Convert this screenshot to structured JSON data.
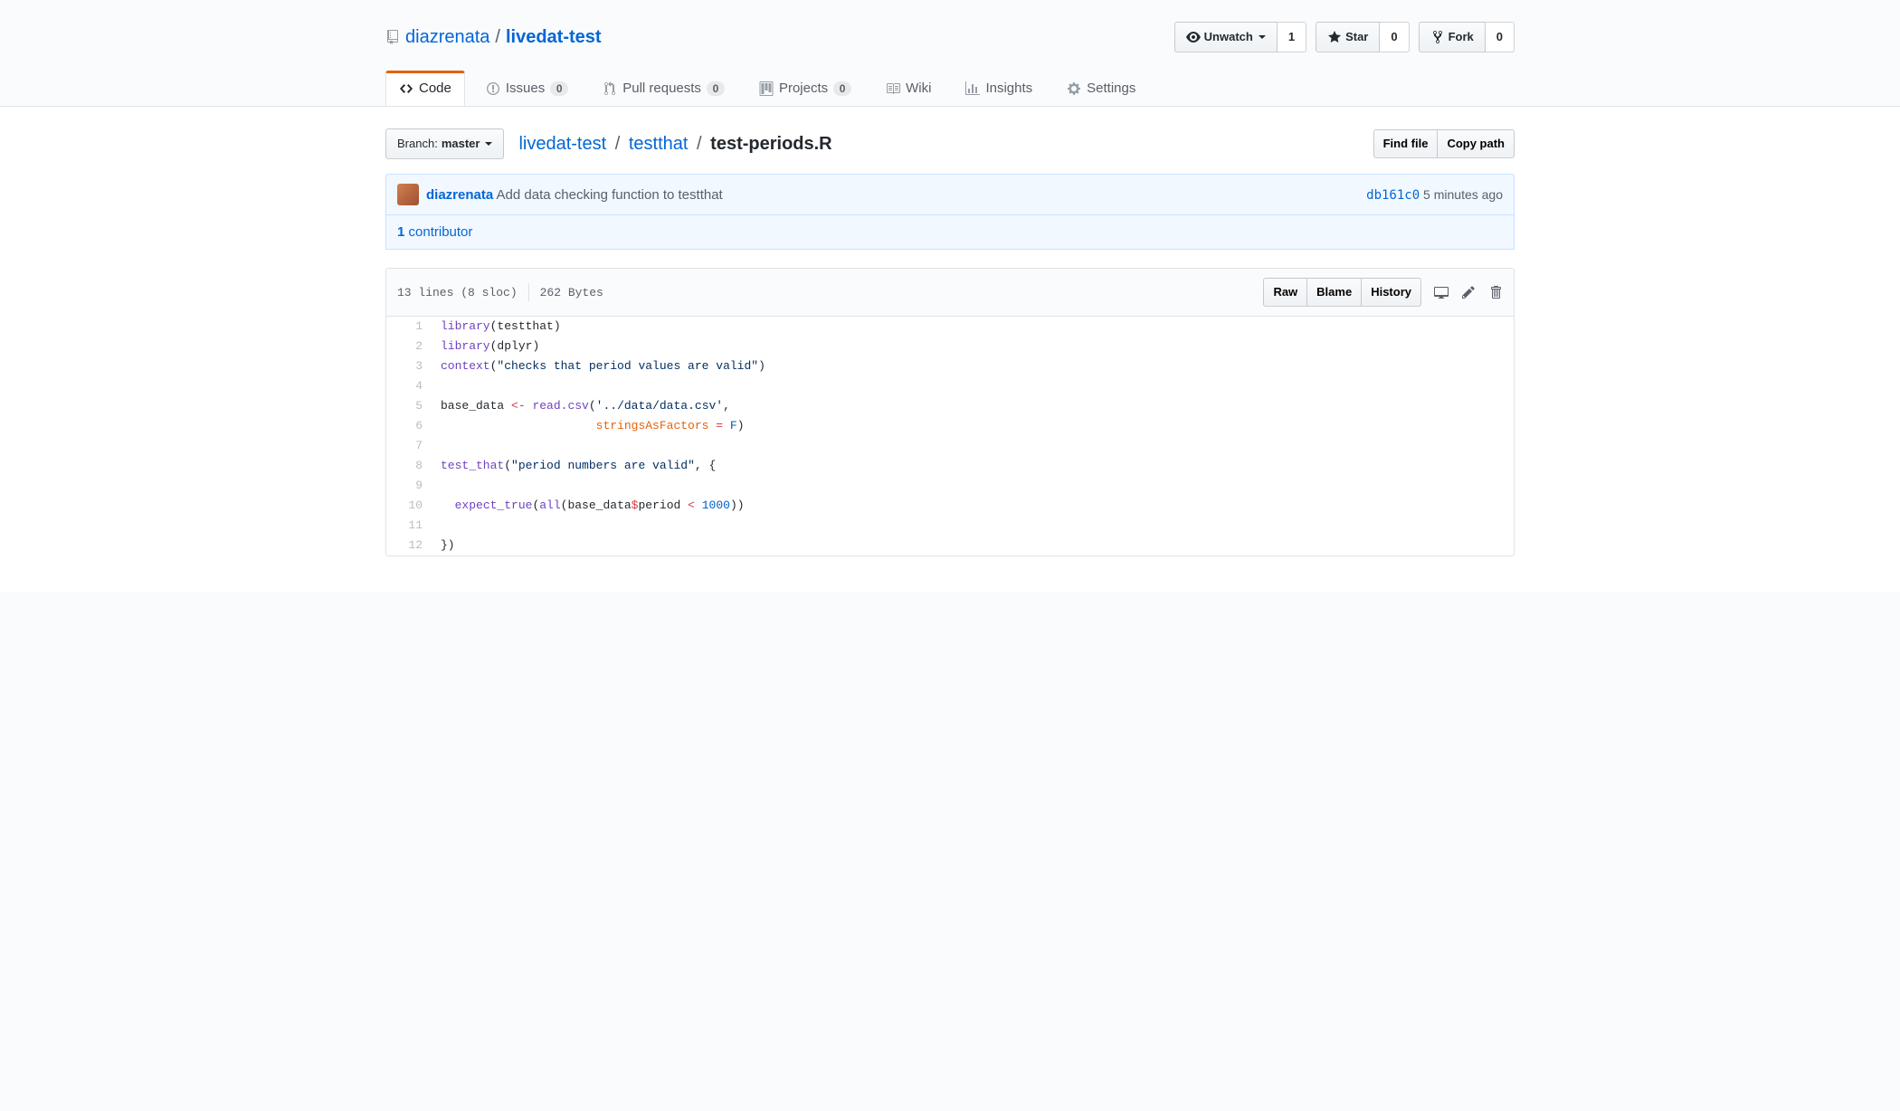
{
  "repo": {
    "owner": "diazrenata",
    "name": "livedat-test",
    "watch_label": "Unwatch",
    "watch_count": "1",
    "star_label": "Star",
    "star_count": "0",
    "fork_label": "Fork",
    "fork_count": "0"
  },
  "tabs": {
    "code": "Code",
    "issues": {
      "label": "Issues",
      "count": "0"
    },
    "pulls": {
      "label": "Pull requests",
      "count": "0"
    },
    "projects": {
      "label": "Projects",
      "count": "0"
    },
    "wiki": "Wiki",
    "insights": "Insights",
    "settings": "Settings"
  },
  "branch": {
    "label_prefix": "Branch:",
    "name": "master"
  },
  "breadcrumb": {
    "root": "livedat-test",
    "dir": "testthat",
    "file": "test-periods.R",
    "sep": "/"
  },
  "buttons": {
    "find_file": "Find file",
    "copy_path": "Copy path",
    "raw": "Raw",
    "blame": "Blame",
    "history": "History"
  },
  "commit": {
    "author": "diazrenata",
    "message": "Add data checking function to testthat",
    "sha": "db161c0",
    "time": "5 minutes ago"
  },
  "contributors": {
    "count": "1",
    "label": "contributor"
  },
  "file_meta": {
    "lines": "13 lines (8 sloc)",
    "bytes": "262 Bytes"
  },
  "code_lines": [
    {
      "n": 1,
      "tokens": [
        {
          "c": "pl-e",
          "t": "library"
        },
        {
          "t": "("
        },
        {
          "t": "testthat"
        },
        {
          "t": ")"
        }
      ]
    },
    {
      "n": 2,
      "tokens": [
        {
          "c": "pl-e",
          "t": "library"
        },
        {
          "t": "("
        },
        {
          "t": "dplyr"
        },
        {
          "t": ")"
        }
      ]
    },
    {
      "n": 3,
      "tokens": [
        {
          "c": "pl-e",
          "t": "context"
        },
        {
          "t": "("
        },
        {
          "c": "pl-s",
          "t": "\"checks that period values are valid\""
        },
        {
          "t": ")"
        }
      ]
    },
    {
      "n": 4,
      "tokens": []
    },
    {
      "n": 5,
      "tokens": [
        {
          "t": "base_data "
        },
        {
          "c": "pl-k",
          "t": "<-"
        },
        {
          "t": " "
        },
        {
          "c": "pl-e",
          "t": "read.csv"
        },
        {
          "t": "("
        },
        {
          "c": "pl-s",
          "t": "'../data/data.csv'"
        },
        {
          "t": ","
        }
      ]
    },
    {
      "n": 6,
      "tokens": [
        {
          "t": "                      "
        },
        {
          "c": "pl-v",
          "t": "stringsAsFactors"
        },
        {
          "t": " "
        },
        {
          "c": "pl-k",
          "t": "="
        },
        {
          "t": " "
        },
        {
          "c": "pl-c1",
          "t": "F"
        },
        {
          "t": ")"
        }
      ]
    },
    {
      "n": 7,
      "tokens": []
    },
    {
      "n": 8,
      "tokens": [
        {
          "c": "pl-e",
          "t": "test_that"
        },
        {
          "t": "("
        },
        {
          "c": "pl-s",
          "t": "\"period numbers are valid\""
        },
        {
          "t": ", {"
        }
      ]
    },
    {
      "n": 9,
      "tokens": []
    },
    {
      "n": 10,
      "tokens": [
        {
          "t": "  "
        },
        {
          "c": "pl-e",
          "t": "expect_true"
        },
        {
          "t": "("
        },
        {
          "c": "pl-e",
          "t": "all"
        },
        {
          "t": "(base_data"
        },
        {
          "c": "pl-k",
          "t": "$"
        },
        {
          "t": "period "
        },
        {
          "c": "pl-k",
          "t": "<"
        },
        {
          "t": " "
        },
        {
          "c": "pl-c1",
          "t": "1000"
        },
        {
          "t": "))"
        }
      ]
    },
    {
      "n": 11,
      "tokens": []
    },
    {
      "n": 12,
      "tokens": [
        {
          "t": "})"
        }
      ]
    }
  ]
}
